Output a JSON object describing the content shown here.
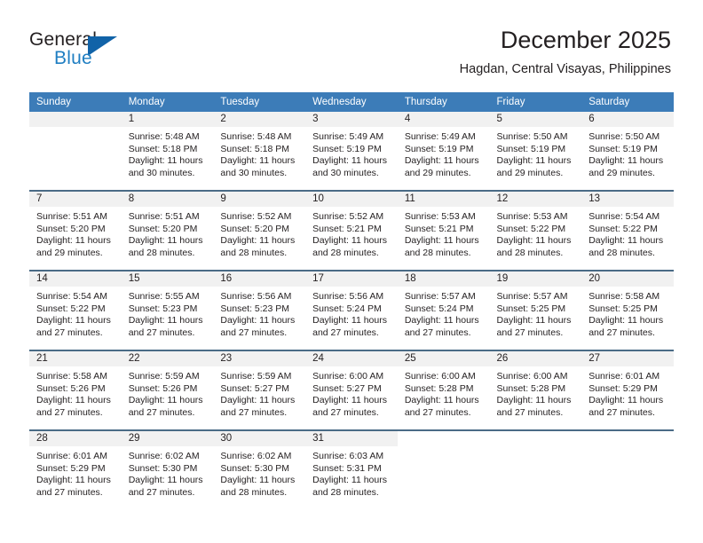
{
  "brand": {
    "name_part1": "General",
    "name_part2": "Blue",
    "logo_icon": "triangle-logo-icon"
  },
  "header": {
    "month_title": "December 2025",
    "location": "Hagdan, Central Visayas, Philippines"
  },
  "theme": {
    "header_blue": "#3c7cb8",
    "row_divider": "#4a6b86",
    "daynum_band": "#f1f1f1",
    "brand_blue": "#1f7ec2",
    "brand_triangle": "#1163a8",
    "text": "#231f20"
  },
  "calendar": {
    "weekday_headers": [
      "Sunday",
      "Monday",
      "Tuesday",
      "Wednesday",
      "Thursday",
      "Friday",
      "Saturday"
    ],
    "weeks": [
      [
        {
          "day": "",
          "blank": true
        },
        {
          "day": "1",
          "sunrise": "Sunrise: 5:48 AM",
          "sunset": "Sunset: 5:18 PM",
          "daylight": "Daylight: 11 hours and 30 minutes."
        },
        {
          "day": "2",
          "sunrise": "Sunrise: 5:48 AM",
          "sunset": "Sunset: 5:18 PM",
          "daylight": "Daylight: 11 hours and 30 minutes."
        },
        {
          "day": "3",
          "sunrise": "Sunrise: 5:49 AM",
          "sunset": "Sunset: 5:19 PM",
          "daylight": "Daylight: 11 hours and 30 minutes."
        },
        {
          "day": "4",
          "sunrise": "Sunrise: 5:49 AM",
          "sunset": "Sunset: 5:19 PM",
          "daylight": "Daylight: 11 hours and 29 minutes."
        },
        {
          "day": "5",
          "sunrise": "Sunrise: 5:50 AM",
          "sunset": "Sunset: 5:19 PM",
          "daylight": "Daylight: 11 hours and 29 minutes."
        },
        {
          "day": "6",
          "sunrise": "Sunrise: 5:50 AM",
          "sunset": "Sunset: 5:19 PM",
          "daylight": "Daylight: 11 hours and 29 minutes."
        }
      ],
      [
        {
          "day": "7",
          "sunrise": "Sunrise: 5:51 AM",
          "sunset": "Sunset: 5:20 PM",
          "daylight": "Daylight: 11 hours and 29 minutes."
        },
        {
          "day": "8",
          "sunrise": "Sunrise: 5:51 AM",
          "sunset": "Sunset: 5:20 PM",
          "daylight": "Daylight: 11 hours and 28 minutes."
        },
        {
          "day": "9",
          "sunrise": "Sunrise: 5:52 AM",
          "sunset": "Sunset: 5:20 PM",
          "daylight": "Daylight: 11 hours and 28 minutes."
        },
        {
          "day": "10",
          "sunrise": "Sunrise: 5:52 AM",
          "sunset": "Sunset: 5:21 PM",
          "daylight": "Daylight: 11 hours and 28 minutes."
        },
        {
          "day": "11",
          "sunrise": "Sunrise: 5:53 AM",
          "sunset": "Sunset: 5:21 PM",
          "daylight": "Daylight: 11 hours and 28 minutes."
        },
        {
          "day": "12",
          "sunrise": "Sunrise: 5:53 AM",
          "sunset": "Sunset: 5:22 PM",
          "daylight": "Daylight: 11 hours and 28 minutes."
        },
        {
          "day": "13",
          "sunrise": "Sunrise: 5:54 AM",
          "sunset": "Sunset: 5:22 PM",
          "daylight": "Daylight: 11 hours and 28 minutes."
        }
      ],
      [
        {
          "day": "14",
          "sunrise": "Sunrise: 5:54 AM",
          "sunset": "Sunset: 5:22 PM",
          "daylight": "Daylight: 11 hours and 27 minutes."
        },
        {
          "day": "15",
          "sunrise": "Sunrise: 5:55 AM",
          "sunset": "Sunset: 5:23 PM",
          "daylight": "Daylight: 11 hours and 27 minutes."
        },
        {
          "day": "16",
          "sunrise": "Sunrise: 5:56 AM",
          "sunset": "Sunset: 5:23 PM",
          "daylight": "Daylight: 11 hours and 27 minutes."
        },
        {
          "day": "17",
          "sunrise": "Sunrise: 5:56 AM",
          "sunset": "Sunset: 5:24 PM",
          "daylight": "Daylight: 11 hours and 27 minutes."
        },
        {
          "day": "18",
          "sunrise": "Sunrise: 5:57 AM",
          "sunset": "Sunset: 5:24 PM",
          "daylight": "Daylight: 11 hours and 27 minutes."
        },
        {
          "day": "19",
          "sunrise": "Sunrise: 5:57 AM",
          "sunset": "Sunset: 5:25 PM",
          "daylight": "Daylight: 11 hours and 27 minutes."
        },
        {
          "day": "20",
          "sunrise": "Sunrise: 5:58 AM",
          "sunset": "Sunset: 5:25 PM",
          "daylight": "Daylight: 11 hours and 27 minutes."
        }
      ],
      [
        {
          "day": "21",
          "sunrise": "Sunrise: 5:58 AM",
          "sunset": "Sunset: 5:26 PM",
          "daylight": "Daylight: 11 hours and 27 minutes."
        },
        {
          "day": "22",
          "sunrise": "Sunrise: 5:59 AM",
          "sunset": "Sunset: 5:26 PM",
          "daylight": "Daylight: 11 hours and 27 minutes."
        },
        {
          "day": "23",
          "sunrise": "Sunrise: 5:59 AM",
          "sunset": "Sunset: 5:27 PM",
          "daylight": "Daylight: 11 hours and 27 minutes."
        },
        {
          "day": "24",
          "sunrise": "Sunrise: 6:00 AM",
          "sunset": "Sunset: 5:27 PM",
          "daylight": "Daylight: 11 hours and 27 minutes."
        },
        {
          "day": "25",
          "sunrise": "Sunrise: 6:00 AM",
          "sunset": "Sunset: 5:28 PM",
          "daylight": "Daylight: 11 hours and 27 minutes."
        },
        {
          "day": "26",
          "sunrise": "Sunrise: 6:00 AM",
          "sunset": "Sunset: 5:28 PM",
          "daylight": "Daylight: 11 hours and 27 minutes."
        },
        {
          "day": "27",
          "sunrise": "Sunrise: 6:01 AM",
          "sunset": "Sunset: 5:29 PM",
          "daylight": "Daylight: 11 hours and 27 minutes."
        }
      ],
      [
        {
          "day": "28",
          "sunrise": "Sunrise: 6:01 AM",
          "sunset": "Sunset: 5:29 PM",
          "daylight": "Daylight: 11 hours and 27 minutes."
        },
        {
          "day": "29",
          "sunrise": "Sunrise: 6:02 AM",
          "sunset": "Sunset: 5:30 PM",
          "daylight": "Daylight: 11 hours and 27 minutes."
        },
        {
          "day": "30",
          "sunrise": "Sunrise: 6:02 AM",
          "sunset": "Sunset: 5:30 PM",
          "daylight": "Daylight: 11 hours and 28 minutes."
        },
        {
          "day": "31",
          "sunrise": "Sunrise: 6:03 AM",
          "sunset": "Sunset: 5:31 PM",
          "daylight": "Daylight: 11 hours and 28 minutes."
        },
        {
          "day": "",
          "void": true
        },
        {
          "day": "",
          "void": true
        },
        {
          "day": "",
          "void": true
        }
      ]
    ]
  }
}
